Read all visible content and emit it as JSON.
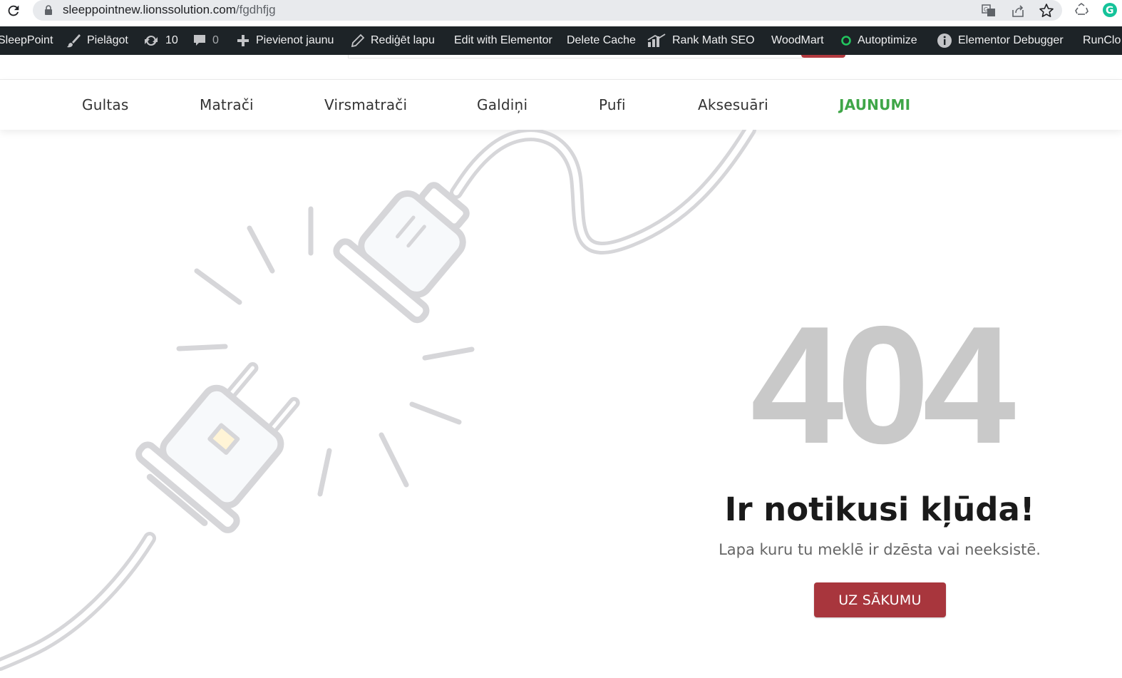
{
  "browser": {
    "url_domain": "sleeppointnew.lionssolution.com",
    "url_path": "/fgdhfjg"
  },
  "adminbar": {
    "site_name": "SleepPoint",
    "customize": "Pielāgot",
    "updates_count": "10",
    "comments_count": "0",
    "new_content": "Pievienot jaunu",
    "edit_page": "Rediģēt lapu",
    "edit_elementor": "Edit with Elementor",
    "delete_cache": "Delete Cache",
    "rank_math": "Rank Math SEO",
    "woodmart": "WoodMart",
    "autoptimize": "Autoptimize",
    "elementor_debugger": "Elementor Debugger",
    "runcloud": "RunClo"
  },
  "nav": {
    "items": [
      "Gultas",
      "Matrači",
      "Virsmatrači",
      "Galdiņi",
      "Pufi",
      "Aksesuāri",
      "JAUNUMI"
    ],
    "active": "JAUNUMI"
  },
  "error": {
    "code": "404",
    "title": "Ir notikusi kļūda!",
    "subtitle": "Lapa kuru tu meklē ir dzēsta vai neeksistē.",
    "button": "UZ SĀKUMU"
  },
  "colors": {
    "nav_active": "#3fa648",
    "button_bg": "#a8363d",
    "code_color": "#c9c9c9",
    "adminbar_bg": "#1d2327"
  },
  "icons": {
    "browser": [
      "reload-icon",
      "lock-icon",
      "translate-icon",
      "share-icon",
      "star-icon",
      "recycle-icon",
      "grammarly-icon"
    ],
    "adminbar": [
      "brush-icon",
      "refresh-icon",
      "comment-icon",
      "plus-icon",
      "pencil-icon",
      "chart-icon",
      "status-dot-icon",
      "info-icon"
    ]
  }
}
